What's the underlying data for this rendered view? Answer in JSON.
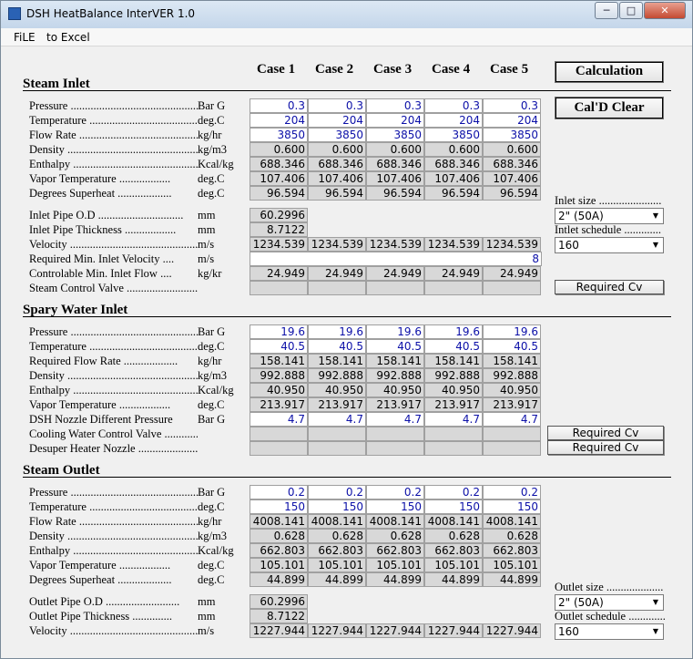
{
  "window": {
    "title": "DSH HeatBalance InterVER 1.0",
    "min": "─",
    "max": "□",
    "close": "✕"
  },
  "menu": [
    "FiLE",
    "to Excel"
  ],
  "cases": [
    "Case 1",
    "Case 2",
    "Case 3",
    "Case 4",
    "Case 5"
  ],
  "buttons": {
    "calculation": "Calculation",
    "clear": "Cal'D Clear",
    "req_cv_steam": "Required Cv",
    "req_cv_cool": "Required Cv",
    "req_cv_nozzle": "Required Cv"
  },
  "sections": {
    "steam_inlet": "Steam Inlet",
    "spray_water": "Spary Water Inlet",
    "steam_outlet": "Steam Outlet"
  },
  "steam_inlet": [
    {
      "label": "Pressure ...............................................",
      "unit": "Bar G",
      "type": "in",
      "values": [
        "0.3",
        "0.3",
        "0.3",
        "0.3",
        "0.3"
      ]
    },
    {
      "label": "Temperature ..........................................",
      "unit": "deg.C",
      "type": "in",
      "values": [
        "204",
        "204",
        "204",
        "204",
        "204"
      ]
    },
    {
      "label": "Flow Rate ...............................................",
      "unit": "kg/hr",
      "type": "in",
      "values": [
        "3850",
        "3850",
        "3850",
        "3850",
        "3850"
      ]
    },
    {
      "label": "Density ....................................................",
      "unit": "kg/m3",
      "type": "out",
      "values": [
        "0.600",
        "0.600",
        "0.600",
        "0.600",
        "0.600"
      ]
    },
    {
      "label": "Enthalpy ..................................................",
      "unit": "Kcal/kg",
      "type": "out",
      "values": [
        "688.346",
        "688.346",
        "688.346",
        "688.346",
        "688.346"
      ]
    },
    {
      "label": "Vapor  Temperature ..................",
      "unit": "deg.C",
      "type": "out",
      "values": [
        "107.406",
        "107.406",
        "107.406",
        "107.406",
        "107.406"
      ]
    },
    {
      "label": "Degrees Superheat ...................",
      "unit": "deg.C",
      "type": "out",
      "values": [
        "96.594",
        "96.594",
        "96.594",
        "96.594",
        "96.594"
      ]
    }
  ],
  "inlet_pipe": [
    {
      "label": "Inlet Pipe O.D ..............................",
      "unit": "mm",
      "type": "out",
      "values": [
        "60.2996"
      ]
    },
    {
      "label": "Inlet Pipe Thickness ..................",
      "unit": "mm",
      "type": "out",
      "values": [
        "8.7122"
      ]
    },
    {
      "label": "Velocity ...................................................",
      "unit": "m/s",
      "type": "out",
      "values": [
        "1234.539",
        "1234.539",
        "1234.539",
        "1234.539",
        "1234.539"
      ]
    },
    {
      "label": "Required Min. Inlet Velocity ....",
      "unit": "m/s",
      "type": "in",
      "wide": true,
      "values": [
        "8"
      ]
    },
    {
      "label": "Controlable Min. Inlet Flow ....",
      "unit": "kg/kr",
      "type": "out",
      "values": [
        "24.949",
        "24.949",
        "24.949",
        "24.949",
        "24.949"
      ]
    },
    {
      "label": "Steam Control Valve ......................................",
      "unit": "",
      "type": "out",
      "values": [
        "",
        "",
        "",
        "",
        ""
      ]
    }
  ],
  "spray_water": [
    {
      "label": "Pressure ...............................................",
      "unit": "Bar G",
      "type": "in",
      "values": [
        "19.6",
        "19.6",
        "19.6",
        "19.6",
        "19.6"
      ]
    },
    {
      "label": "Temperature ..........................................",
      "unit": "deg.C",
      "type": "in",
      "values": [
        "40.5",
        "40.5",
        "40.5",
        "40.5",
        "40.5"
      ]
    },
    {
      "label": "Required Flow Rate ...................",
      "unit": "kg/hr",
      "type": "out",
      "values": [
        "158.141",
        "158.141",
        "158.141",
        "158.141",
        "158.141"
      ]
    },
    {
      "label": "Density ....................................................",
      "unit": "kg/m3",
      "type": "out",
      "values": [
        "992.888",
        "992.888",
        "992.888",
        "992.888",
        "992.888"
      ]
    },
    {
      "label": "Enthalpy ..................................................",
      "unit": "Kcal/kg",
      "type": "out",
      "values": [
        "40.950",
        "40.950",
        "40.950",
        "40.950",
        "40.950"
      ]
    },
    {
      "label": "Vapor  Temperature ..................",
      "unit": "deg.C",
      "type": "out",
      "values": [
        "213.917",
        "213.917",
        "213.917",
        "213.917",
        "213.917"
      ]
    },
    {
      "label": "DSH Nozzle Different Pressure",
      "unit": "Bar G",
      "type": "in",
      "values": [
        "4.7",
        "4.7",
        "4.7",
        "4.7",
        "4.7"
      ]
    },
    {
      "label": "Cooling Water Control Valve ......................",
      "unit": "",
      "type": "out",
      "values": [
        "",
        "",
        "",
        "",
        ""
      ]
    },
    {
      "label": "Desuper Heater Nozzle .................................",
      "unit": "",
      "type": "out",
      "values": [
        "",
        "",
        "",
        "",
        ""
      ]
    }
  ],
  "steam_outlet": [
    {
      "label": "Pressure ...............................................",
      "unit": "Bar G",
      "type": "in",
      "values": [
        "0.2",
        "0.2",
        "0.2",
        "0.2",
        "0.2"
      ]
    },
    {
      "label": "Temperature ..........................................",
      "unit": "deg.C",
      "type": "in",
      "values": [
        "150",
        "150",
        "150",
        "150",
        "150"
      ]
    },
    {
      "label": "Flow Rate ...............................................",
      "unit": "kg/hr",
      "type": "out",
      "values": [
        "4008.141",
        "4008.141",
        "4008.141",
        "4008.141",
        "4008.141"
      ]
    },
    {
      "label": "Density ....................................................",
      "unit": "kg/m3",
      "type": "out",
      "values": [
        "0.628",
        "0.628",
        "0.628",
        "0.628",
        "0.628"
      ]
    },
    {
      "label": "Enthalpy ..................................................",
      "unit": "Kcal/kg",
      "type": "out",
      "values": [
        "662.803",
        "662.803",
        "662.803",
        "662.803",
        "662.803"
      ]
    },
    {
      "label": "Vapor  Temperature ..................",
      "unit": "deg.C",
      "type": "out",
      "values": [
        "105.101",
        "105.101",
        "105.101",
        "105.101",
        "105.101"
      ]
    },
    {
      "label": "Degrees Superheat ...................",
      "unit": "deg.C",
      "type": "out",
      "values": [
        "44.899",
        "44.899",
        "44.899",
        "44.899",
        "44.899"
      ]
    }
  ],
  "outlet_pipe": [
    {
      "label": "Outlet Pipe O.D ..........................",
      "unit": "mm",
      "type": "out",
      "values": [
        "60.2996"
      ]
    },
    {
      "label": "Outlet Pipe Thickness ..............",
      "unit": "mm",
      "type": "out",
      "values": [
        "8.7122"
      ]
    },
    {
      "label": "Velocity ...................................................",
      "unit": "m/s",
      "type": "out",
      "values": [
        "1227.944",
        "1227.944",
        "1227.944",
        "1227.944",
        "1227.944"
      ]
    }
  ],
  "side": {
    "inlet_size_label": "Inlet size ......................",
    "inlet_size": "2\"  (50A)",
    "inlet_sched_label": "Intlet schedule .............",
    "inlet_sched": "160",
    "outlet_size_label": "Outlet size ....................",
    "outlet_size": "2\"  (50A)",
    "outlet_sched_label": "Outlet schedule .............",
    "outlet_sched": "160"
  }
}
